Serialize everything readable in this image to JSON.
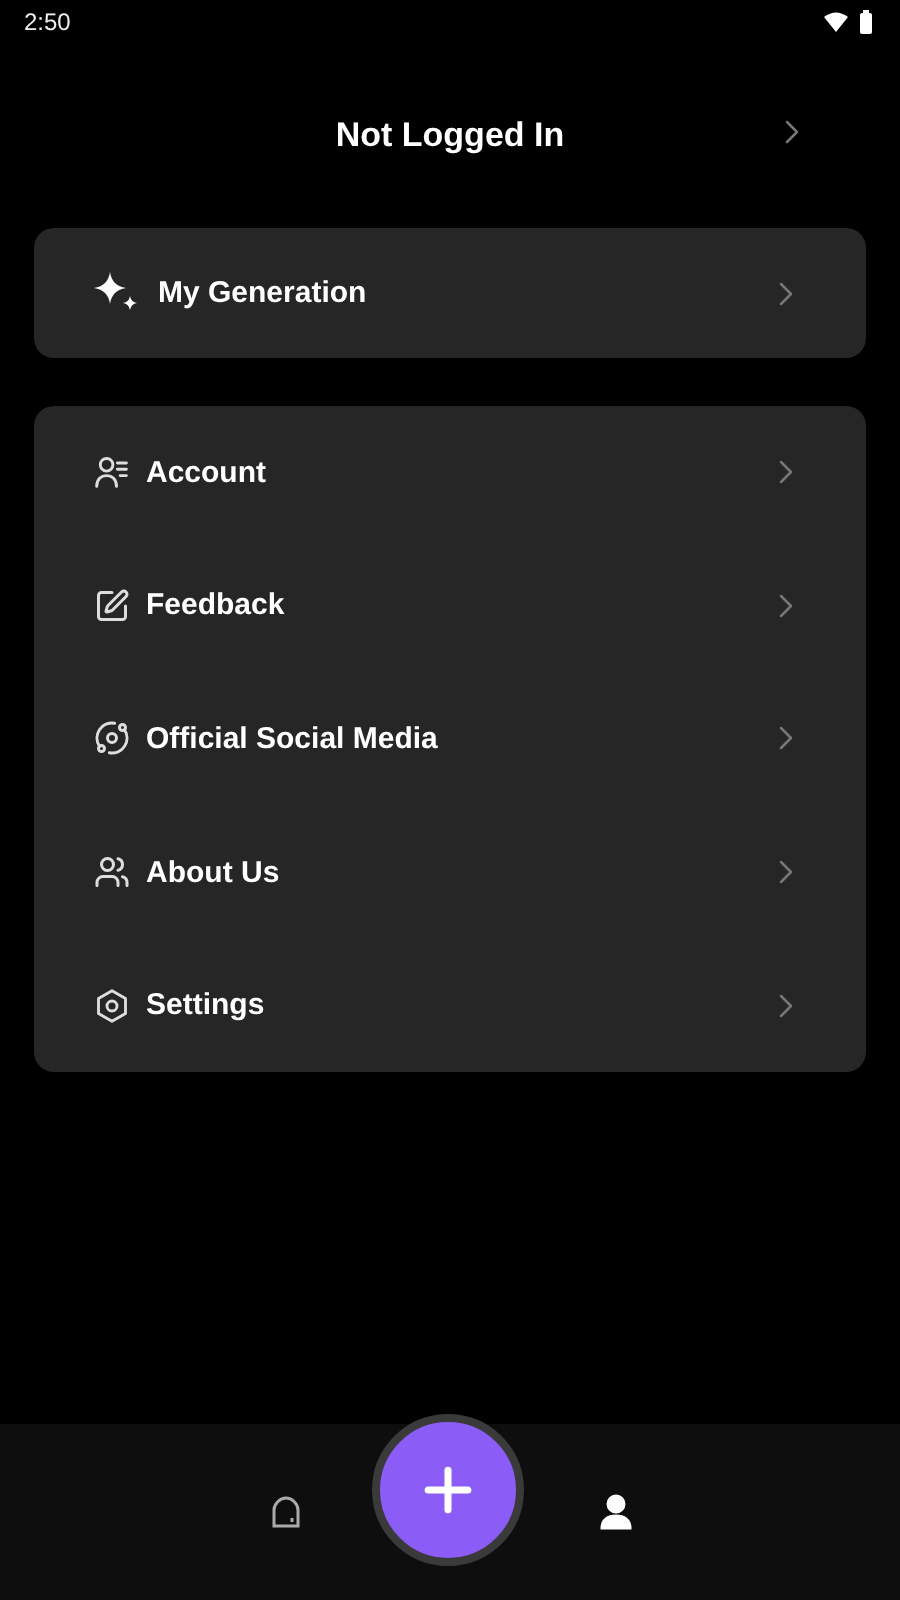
{
  "status_bar": {
    "time": "2:50"
  },
  "header": {
    "title": "Not Logged In"
  },
  "featured": {
    "kind": "sparkles",
    "label": "My Generation"
  },
  "menu": [
    {
      "kind": "account",
      "label": "Account"
    },
    {
      "kind": "feedback",
      "label": "Feedback"
    },
    {
      "kind": "planet",
      "label": "Official Social Media"
    },
    {
      "kind": "people",
      "label": "About Us"
    },
    {
      "kind": "settings",
      "label": "Settings"
    }
  ],
  "bottom_nav": [
    {
      "kind": "home",
      "selected": false
    },
    {
      "kind": "profile",
      "selected": true
    }
  ]
}
